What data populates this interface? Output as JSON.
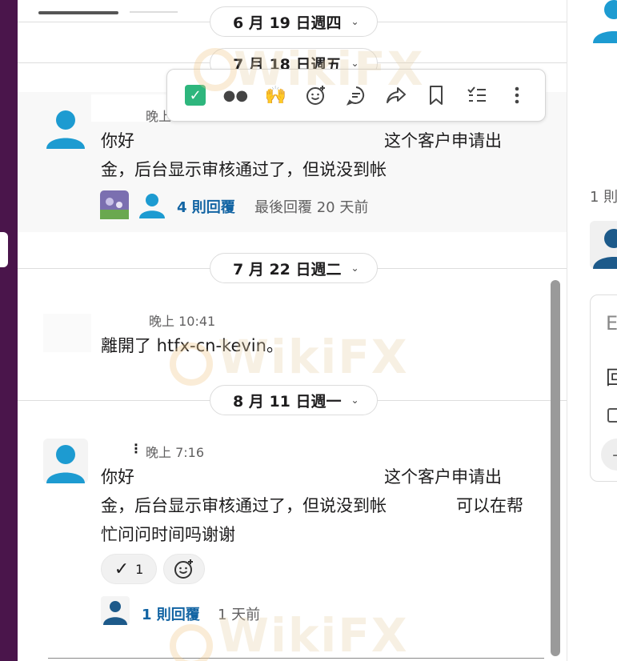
{
  "dates": {
    "d1": "6 月 19 日週四",
    "d2": "7 月 18 日週五",
    "d3": "7 月 22 日週二",
    "d4": "8 月 11 日週一"
  },
  "toolbar": {
    "icons": [
      "check-mark-icon",
      "eyes-icon",
      "raised-hands-icon",
      "add-reaction-icon",
      "reply-in-thread-icon",
      "share-icon",
      "bookmark-icon",
      "checklist-icon",
      "more-actions-icon"
    ]
  },
  "messages": [
    {
      "time": "晚上",
      "line1": "你好",
      "line1_right": "这个客户申请出",
      "line2": "金，后台显示审核通过了，但说没到帐",
      "thread_link": "4 則回覆",
      "thread_meta": "最後回覆 20 天前"
    },
    {
      "time": "晚上 10:41",
      "line1": "離開了 htfx-cn-kevin。"
    },
    {
      "time": "晚上 7:16",
      "dots": "⋮",
      "line1": "你好",
      "line1_right": "这个客户申请出",
      "line2": "金，后台显示审核通过了，但说没到帐",
      "line2_right": "可以在帮",
      "line3": "忙问问时间吗谢谢",
      "reaction_count": "1",
      "thread_link": "1 則回覆",
      "thread_meta": "1 天前"
    }
  ],
  "watermark": "WikiFX",
  "right_panel": {
    "reply_count": "1 則",
    "input_placeholder_fragment": "E",
    "text_fragment": "回"
  },
  "colors": {
    "sidebar": "#4a154b",
    "link": "#1264a3",
    "avatar": "#1d9bd1",
    "avatar_dark": "#1d5a8a"
  }
}
